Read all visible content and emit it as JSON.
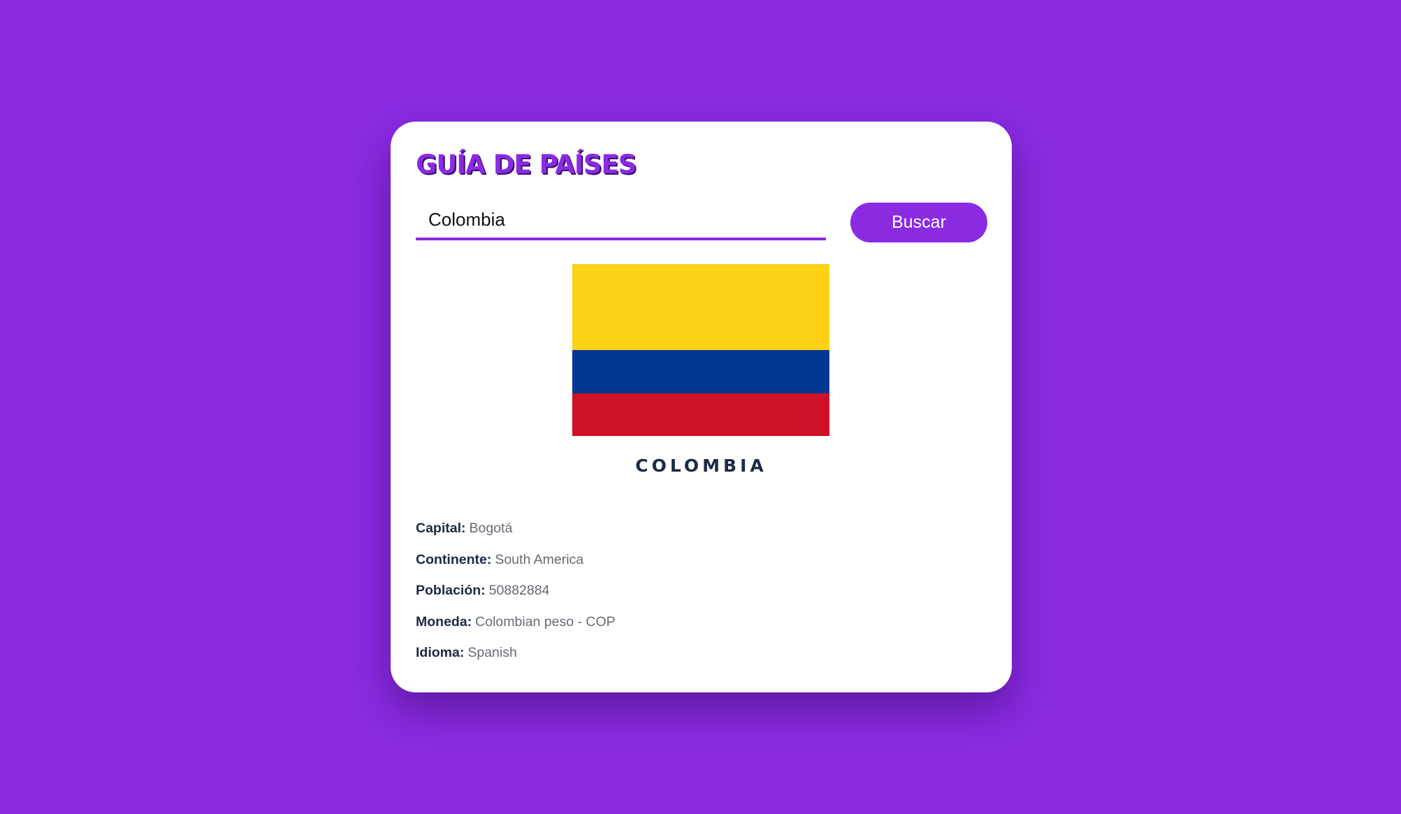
{
  "app": {
    "title": "GUÍA DE PAÍSES"
  },
  "search": {
    "value": "Colombia",
    "button_label": "Buscar"
  },
  "country": {
    "name": "COLOMBIA",
    "flag_colors": {
      "yellow": "#fcd116",
      "blue": "#003893",
      "red": "#ce1126"
    },
    "details": [
      {
        "label": "Capital:",
        "value": "Bogotá"
      },
      {
        "label": "Continente:",
        "value": "South America"
      },
      {
        "label": "Población:",
        "value": "50882884"
      },
      {
        "label": "Moneda:",
        "value": "Colombian peso - COP"
      },
      {
        "label": "Idioma:",
        "value": "Spanish"
      }
    ]
  },
  "theme": {
    "accent": "#8a2be2",
    "background": "#8a2be2",
    "card": "#ffffff",
    "text_dark": "#1e2a45",
    "text_muted": "#666a73"
  }
}
